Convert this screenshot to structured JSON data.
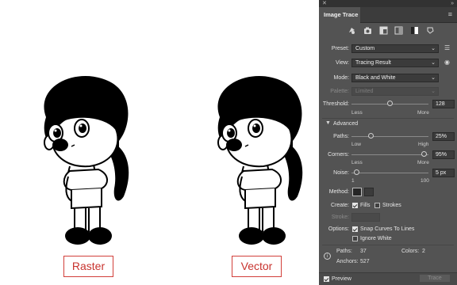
{
  "captions": {
    "left": "Raster",
    "right": "Vector"
  },
  "panel": {
    "title": "Image Trace",
    "preset_icons": [
      "auto-color-icon",
      "high-color-icon",
      "low-color-icon",
      "grayscale-icon",
      "black-and-white-icon",
      "outline-icon"
    ],
    "preset": {
      "label": "Preset:",
      "value": "Custom"
    },
    "view": {
      "label": "View:",
      "value": "Tracing Result"
    },
    "mode": {
      "label": "Mode:",
      "value": "Black and White"
    },
    "palette": {
      "label": "Palette:",
      "value": "Limited"
    },
    "threshold": {
      "label": "Threshold:",
      "value": "128",
      "min_label": "Less",
      "max_label": "More",
      "level": 0.5
    },
    "advanced_label": "Advanced",
    "paths": {
      "label": "Paths:",
      "value": "25%",
      "min_label": "Low",
      "max_label": "High",
      "level": 0.25
    },
    "corners": {
      "label": "Corners:",
      "value": "95%",
      "min_label": "Less",
      "max_label": "More",
      "level": 0.95
    },
    "noise": {
      "label": "Noise:",
      "value": "5 px",
      "min_label": "1",
      "max_label": "100",
      "level": 0.04
    },
    "method": {
      "label": "Method:"
    },
    "create": {
      "label": "Create:",
      "fills_label": "Fills",
      "fills_checked": true,
      "strokes_label": "Strokes",
      "strokes_checked": false
    },
    "stroke": {
      "label": "Stroke:"
    },
    "options": {
      "label": "Options:",
      "snap_label": "Snap Curves To Lines",
      "snap_checked": true,
      "ignore_white_label": "Ignore White",
      "ignore_white_checked": false
    },
    "stats": {
      "paths_label": "Paths:",
      "paths_value": "37",
      "colors_label": "Colors:",
      "colors_value": "2",
      "anchors_label": "Anchors:",
      "anchors_value": "527"
    },
    "preview": {
      "label": "Preview",
      "checked": true
    },
    "trace_button": "Trace"
  }
}
